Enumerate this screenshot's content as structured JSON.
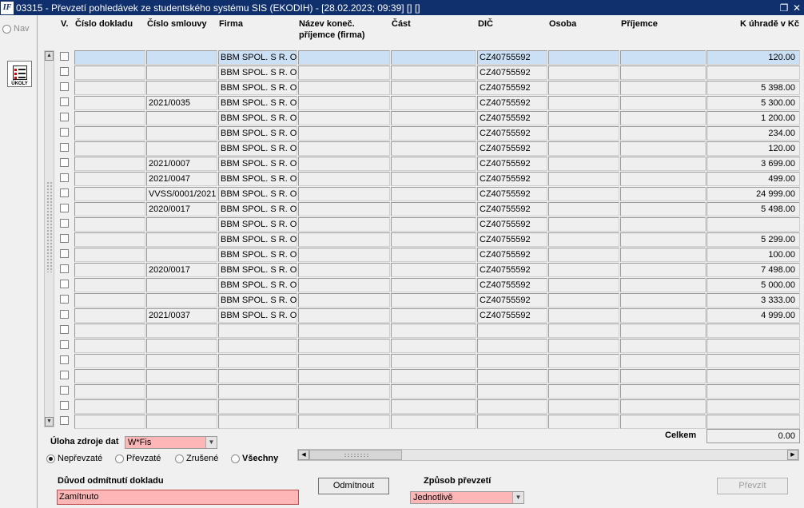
{
  "window": {
    "title": "03315 - Převzetí pohledávek ze studentského systému SIS (EKODIH) - [28.02.2023; 09:39]  []  []",
    "app_icon": "IF",
    "restore_icon": "restore-icon",
    "close_icon": "close-icon"
  },
  "left_panel": {
    "nav_label": "Nav",
    "ukoly_label": "ÚKOLY"
  },
  "columns": [
    "V.",
    "Číslo dokladu",
    "Číslo smlouvy",
    "Firma",
    "Název koneč. příjemce (firma)",
    "Část",
    "DIČ",
    "Osoba",
    "Příjemce",
    "K úhradě v Kč"
  ],
  "rows": [
    {
      "cislo_smlouvy": "",
      "firma": "BBM SPOL. S R. O.",
      "dic": "CZ40755592",
      "k_uhrade": "120.00",
      "selected": true
    },
    {
      "cislo_smlouvy": "",
      "firma": "BBM SPOL. S R. O.",
      "dic": "CZ40755592",
      "k_uhrade": ""
    },
    {
      "cislo_smlouvy": "",
      "firma": "BBM SPOL. S R. O.",
      "dic": "CZ40755592",
      "k_uhrade": "5 398.00"
    },
    {
      "cislo_smlouvy": "2021/0035",
      "firma": "BBM SPOL. S R. O.",
      "dic": "CZ40755592",
      "k_uhrade": "5 300.00"
    },
    {
      "cislo_smlouvy": "",
      "firma": "BBM SPOL. S R. O.",
      "dic": "CZ40755592",
      "k_uhrade": "1 200.00"
    },
    {
      "cislo_smlouvy": "",
      "firma": "BBM SPOL. S R. O.",
      "dic": "CZ40755592",
      "k_uhrade": "234.00"
    },
    {
      "cislo_smlouvy": "",
      "firma": "BBM SPOL. S R. O.",
      "dic": "CZ40755592",
      "k_uhrade": "120.00"
    },
    {
      "cislo_smlouvy": "2021/0007",
      "firma": "BBM SPOL. S R. O.",
      "dic": "CZ40755592",
      "k_uhrade": "3 699.00"
    },
    {
      "cislo_smlouvy": "2021/0047",
      "firma": "BBM SPOL. S R. O.",
      "dic": "CZ40755592",
      "k_uhrade": "499.00"
    },
    {
      "cislo_smlouvy": "VVSS/0001/2021",
      "firma": "BBM SPOL. S R. O.",
      "dic": "CZ40755592",
      "k_uhrade": "24 999.00"
    },
    {
      "cislo_smlouvy": "2020/0017",
      "firma": "BBM SPOL. S R. O.",
      "dic": "CZ40755592",
      "k_uhrade": "5 498.00"
    },
    {
      "cislo_smlouvy": "",
      "firma": "BBM SPOL. S R. O.",
      "dic": "CZ40755592",
      "k_uhrade": ""
    },
    {
      "cislo_smlouvy": "",
      "firma": "BBM SPOL. S R. O.",
      "dic": "CZ40755592",
      "k_uhrade": "5 299.00"
    },
    {
      "cislo_smlouvy": "",
      "firma": "BBM SPOL. S R. O.",
      "dic": "CZ40755592",
      "k_uhrade": "100.00"
    },
    {
      "cislo_smlouvy": "2020/0017",
      "firma": "BBM SPOL. S R. O.",
      "dic": "CZ40755592",
      "k_uhrade": "7 498.00"
    },
    {
      "cislo_smlouvy": "",
      "firma": "BBM SPOL. S R. O.",
      "dic": "CZ40755592",
      "k_uhrade": "5 000.00"
    },
    {
      "cislo_smlouvy": "",
      "firma": "BBM SPOL. S R. O.",
      "dic": "CZ40755592",
      "k_uhrade": "3 333.00"
    },
    {
      "cislo_smlouvy": "2021/0037",
      "firma": "BBM SPOL. S R. O.",
      "dic": "CZ40755592",
      "k_uhrade": "4 999.00"
    },
    {},
    {},
    {},
    {},
    {},
    {},
    {}
  ],
  "footer": {
    "uloha_label": "Úloha zdroje dat",
    "uloha_value": "W*Fis",
    "celkem_label": "Celkem",
    "celkem_value": "0.00",
    "radios": [
      {
        "label": "Nepřevzaté",
        "checked": true
      },
      {
        "label": "Převzaté",
        "checked": false
      },
      {
        "label": "Zrušené",
        "checked": false
      },
      {
        "label": "Všechny",
        "checked": false,
        "bold": true
      }
    ],
    "duvod_label": "Důvod odmítnutí dokladu",
    "duvod_value": "Zamítnuto",
    "odmitnout_label": "Odmítnout",
    "zpusob_label": "Způsob převzetí",
    "zpusob_value": "Jednotlivě",
    "prevzit_label": "Převzít"
  },
  "colors": {
    "titlebar": "#0f2f6d",
    "selected_row": "#cce0f5",
    "required_field": "#ffb6b6"
  }
}
